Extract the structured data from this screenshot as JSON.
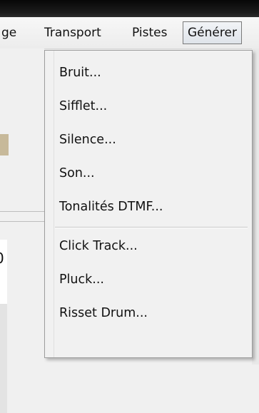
{
  "menubar": {
    "items": [
      {
        "label": "ge"
      },
      {
        "label": "Transport"
      },
      {
        "label": "Pistes"
      },
      {
        "label": "Générer",
        "active": true
      }
    ]
  },
  "background_window": {
    "partial_digit": "0"
  },
  "dropdown": {
    "items": [
      {
        "label": "Bruit..."
      },
      {
        "label": "Sifflet..."
      },
      {
        "label": "Silence..."
      },
      {
        "label": "Son..."
      },
      {
        "label": "Tonalités DTMF..."
      },
      {
        "label": "Click Track..."
      },
      {
        "label": "Pluck..."
      },
      {
        "label": "Risset Drum..."
      }
    ]
  },
  "colors": {
    "menubar_background": "#eeeeee",
    "active_menu_border": "#7a7a7a",
    "dropdown_background": "#f1f1f1",
    "dropdown_border": "#9c9c9c",
    "separator": "#c8c8c8"
  }
}
